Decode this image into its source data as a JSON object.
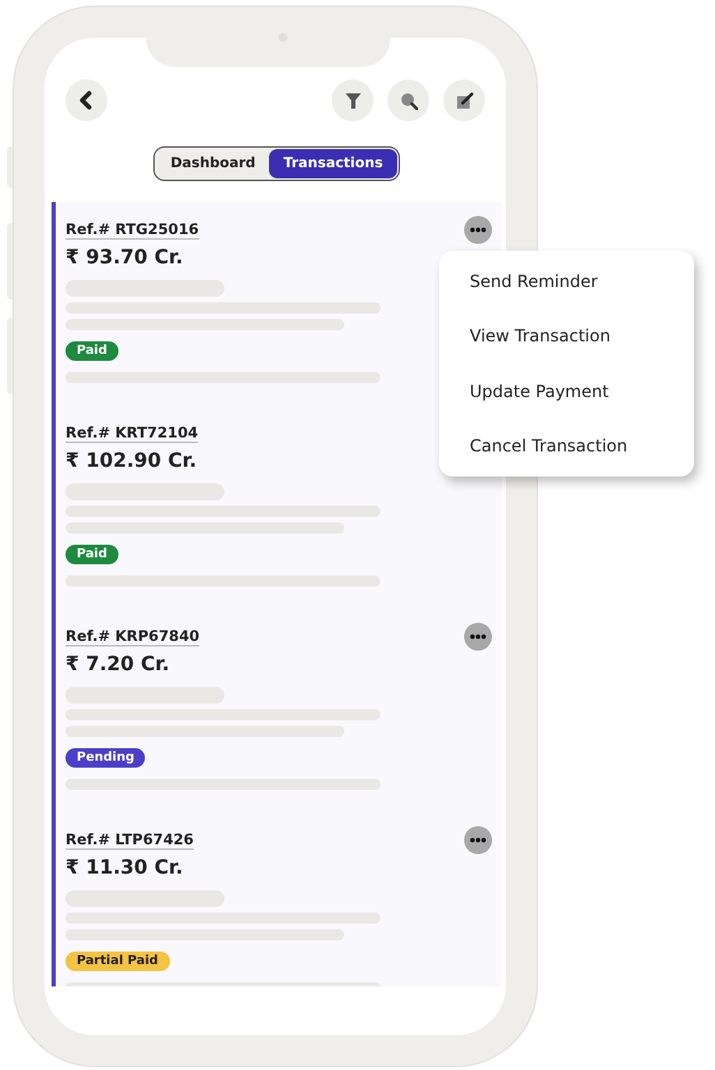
{
  "tabs": [
    {
      "label": "Dashboard",
      "selected": false
    },
    {
      "label": "Transactions",
      "selected": true
    }
  ],
  "transactions": [
    {
      "ref": "Ref.# RTG25016",
      "amount": "₹ 93.70 Cr.",
      "status": {
        "label": "Paid",
        "kind": "paid"
      },
      "more_button": true
    },
    {
      "ref": "Ref.# KRT72104",
      "amount": "₹ 102.90 Cr.",
      "status": {
        "label": "Paid",
        "kind": "paid"
      },
      "more_button": false
    },
    {
      "ref": "Ref.# KRP67840",
      "amount": "₹ 7.20 Cr.",
      "status": {
        "label": "Pending",
        "kind": "pending"
      },
      "more_button": true
    },
    {
      "ref": "Ref.# LTP67426",
      "amount": "₹ 11.30 Cr.",
      "status": {
        "label": "Partial Paid",
        "kind": "partial"
      },
      "more_button": true
    }
  ],
  "menu": {
    "open": true,
    "items": [
      "Send Reminder",
      "View Transaction",
      "Update Payment",
      "Cancel Transaction"
    ]
  }
}
